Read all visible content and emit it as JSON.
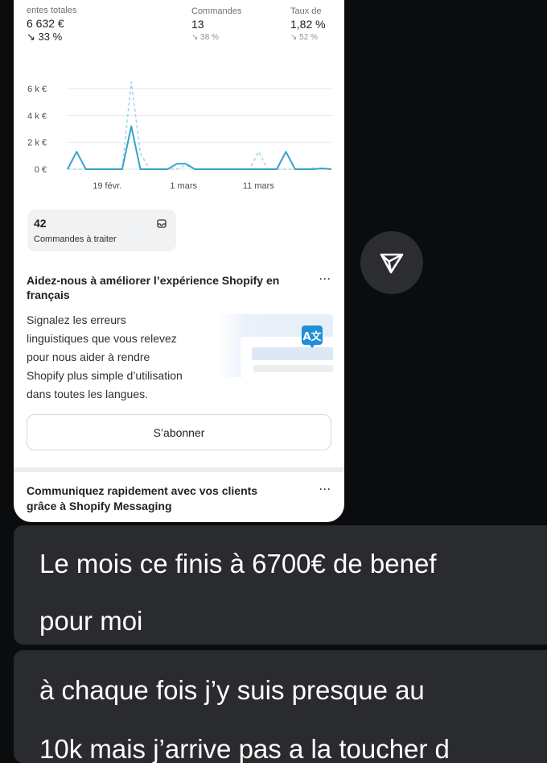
{
  "metrics": [
    {
      "label": "entes totales",
      "value": "6 632 €",
      "delta": "↘ 33 %"
    },
    {
      "label": "Commandes",
      "value": "13",
      "delta": "↘ 38 %"
    },
    {
      "label": "Taux de",
      "value": "1,82 %",
      "delta": "↘ 52 %"
    }
  ],
  "chart_data": {
    "type": "line",
    "y_tick_labels": [
      "6 k €",
      "4 k €",
      "2 k €",
      "0 €"
    ],
    "x_tick_labels": [
      "19 févr.",
      "1 mars",
      "11 mars"
    ],
    "ylim": [
      0,
      6000
    ],
    "grid": true,
    "series": [
      {
        "style": "solid",
        "color": "#36a3c8",
        "x": [
          0,
          1,
          2,
          3,
          4,
          5,
          6,
          7,
          8,
          9,
          10,
          11,
          12,
          13,
          14,
          15,
          16,
          17,
          18,
          19,
          20,
          21,
          22,
          23,
          24,
          25,
          26,
          27,
          28,
          29
        ],
        "values": [
          0,
          1300,
          0,
          0,
          0,
          0,
          0,
          3200,
          0,
          0,
          0,
          0,
          400,
          400,
          0,
          0,
          0,
          0,
          0,
          0,
          0,
          0,
          0,
          0,
          1300,
          0,
          0,
          0,
          60,
          0
        ]
      },
      {
        "style": "dashed",
        "color": "#a9d6e6",
        "x": [
          0,
          1,
          2,
          3,
          4,
          5,
          6,
          7,
          8,
          9,
          10,
          11,
          12,
          13,
          14,
          15,
          16,
          17,
          18,
          19,
          20,
          21,
          22,
          23,
          24,
          25,
          26,
          27,
          28,
          29
        ],
        "values": [
          0,
          0,
          0,
          0,
          0,
          0,
          0,
          6500,
          1200,
          0,
          0,
          0,
          0,
          300,
          0,
          0,
          0,
          0,
          0,
          0,
          0,
          1300,
          0,
          0,
          0,
          0,
          0,
          100,
          0,
          0
        ]
      }
    ]
  },
  "pending": {
    "count": "42",
    "label": "Commandes à traiter"
  },
  "help_card": {
    "title": "Aidez-nous à améliorer l’expérience Shopify en français",
    "text_lines": [
      "Signalez les erreurs",
      "linguistiques que vous relevez",
      "pour nous aider à rendre",
      "Shopify plus simple d’utilisation",
      "dans toutes les langues."
    ],
    "button": "S’abonner"
  },
  "messaging_card": {
    "title": "Communiquez rapidement avec vos clients grâce à Shopify Messaging"
  },
  "menu_dots": "···",
  "messages": [
    {
      "lines": [
        "Le mois ce finis à 6700€ de benef",
        "pour moi"
      ]
    },
    {
      "lines": [
        "à chaque fois j’y suis presque au",
        "10k mais j’arrive pas a la toucher d"
      ]
    }
  ],
  "colors": {
    "accent_line": "#36a3c8",
    "app_bg": "#0b0c0e",
    "bubble_bg": "#2a2b2f",
    "translate_badge": "#1f8fd6"
  },
  "icons": [
    "inbox-icon",
    "translate-icon",
    "share-send-icon",
    "menu-dots-icon"
  ]
}
